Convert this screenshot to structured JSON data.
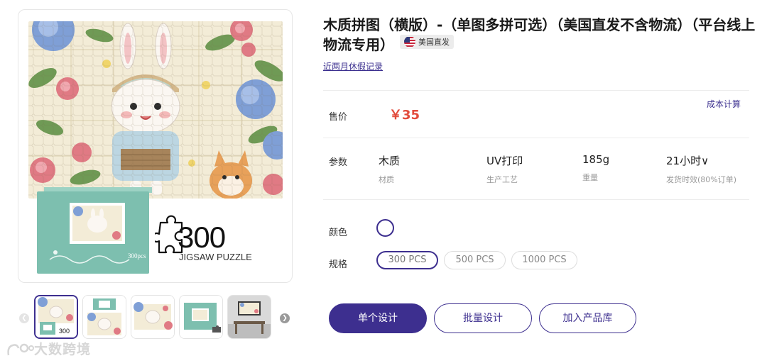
{
  "product": {
    "title": "木质拼图（横版）-（单图多拼可选）（美国直发不含物流）（平台线上物流专用）",
    "origin_badge": "美国直发",
    "holiday_link": "近两月休假记录"
  },
  "gallery": {
    "count_text": "300",
    "count_sub": "JIGSAW PUZZLE",
    "box_label": "300pcs",
    "thumb_label": "300",
    "thumbs": [
      "thumb-puzzle-with-box",
      "thumb-puzzle-boxes",
      "thumb-puzzle-flat",
      "thumb-green-box",
      "thumb-room-scene"
    ],
    "active_thumb": 0
  },
  "pricing": {
    "label": "售价",
    "value": "￥35",
    "cost_calc": "成本计算"
  },
  "params": {
    "label": "参数",
    "items": [
      {
        "value": "木质",
        "caption": "材质"
      },
      {
        "value": "UV打印",
        "caption": "生产工艺"
      },
      {
        "value": "185g",
        "caption": "重量"
      },
      {
        "value": "21小时∨",
        "caption": "发货时效(80%订单)"
      }
    ]
  },
  "color": {
    "label": "颜色",
    "swatches": [
      "#ffffff"
    ]
  },
  "spec": {
    "label": "规格",
    "options": [
      "300 PCS",
      "500 PCS",
      "1000 PCS"
    ],
    "selected": 0
  },
  "actions": {
    "single": "单个设计",
    "batch": "批量设计",
    "add_library": "加入产品库"
  },
  "watermark": "大数跨境",
  "colors": {
    "accent": "#3d2f8f",
    "price": "#e24b3c",
    "box": "#7dbfaf"
  }
}
